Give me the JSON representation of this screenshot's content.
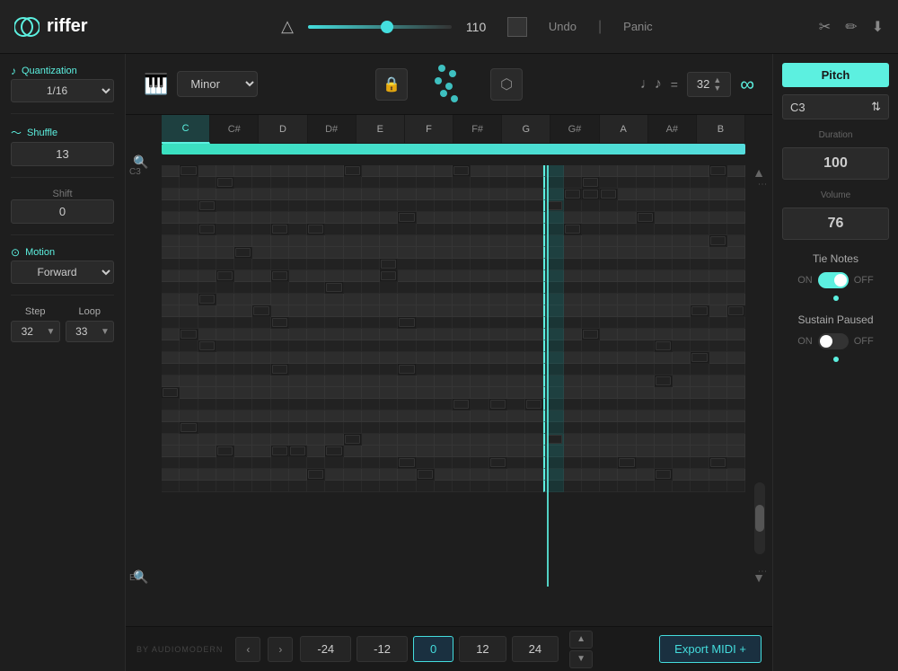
{
  "app": {
    "name": "riffer",
    "title": "riffer"
  },
  "header": {
    "tempo": "110",
    "undo_label": "Undo",
    "panic_label": "Panic"
  },
  "toolbar": {
    "scale_label": "Minor",
    "note_value": "32",
    "loop_symbol": "∞"
  },
  "sidebar": {
    "quantization_label": "Quantization",
    "quantization_value": "1/16",
    "shuffle_label": "Shuffle",
    "shuffle_value": "13",
    "shift_label": "Shift",
    "shift_value": "0",
    "motion_label": "Motion",
    "motion_value": "Forward",
    "step_label": "Step",
    "step_value": "32",
    "loop_label": "Loop",
    "loop_value": "33"
  },
  "grid": {
    "note_start": "C3",
    "note_end": "E1",
    "notes": [
      "C",
      "C#",
      "D",
      "D#",
      "E",
      "F",
      "F#",
      "G",
      "G#",
      "A",
      "A#",
      "B"
    ],
    "active_note": "C",
    "playhead_pct": 66
  },
  "right_panel": {
    "pitch_label": "Pitch",
    "pitch_value": "C3",
    "duration_label": "Duration",
    "duration_value": "100",
    "volume_label": "Volume",
    "volume_value": "76",
    "tie_notes_label": "Tie Notes",
    "tie_on": "ON",
    "tie_off": "OFF",
    "sustain_label": "Sustain Paused",
    "sustain_on": "ON",
    "sustain_off": "OFF"
  },
  "bottom_bar": {
    "by_label": "by AUDIOMODERN",
    "transpose_values": [
      "-24",
      "-12",
      "0",
      "12",
      "24"
    ],
    "active_transpose": "0",
    "export_label": "Export MIDI +"
  }
}
